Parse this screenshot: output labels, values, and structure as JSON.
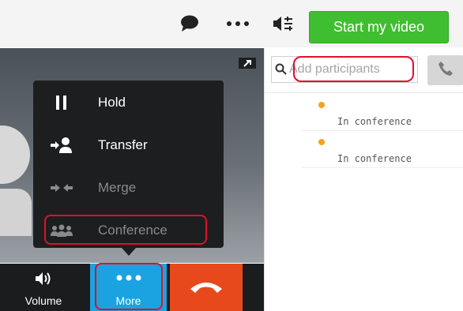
{
  "toolbar": {
    "chat_icon": "chat-bubble-icon",
    "more_icon": "ellipsis-icon",
    "layout_icon": "layout-toggle-icon",
    "start_video_label": "Start my video"
  },
  "call_menu": {
    "items": [
      {
        "label": "Hold",
        "icon": "pause-icon",
        "enabled": true
      },
      {
        "label": "Transfer",
        "icon": "transfer-icon",
        "enabled": true
      },
      {
        "label": "Merge",
        "icon": "merge-icon",
        "enabled": false
      },
      {
        "label": "Conference",
        "icon": "conference-icon",
        "enabled": false
      }
    ]
  },
  "controls": {
    "volume_label": "Volume",
    "more_label": "More",
    "hangup_icon": "hang-up-icon"
  },
  "participants_panel": {
    "search_placeholder": "Add participants",
    "participants": [
      {
        "status": "In conference"
      },
      {
        "status": "In conference"
      }
    ]
  },
  "colors": {
    "start_video": "#3fbf2f",
    "more_active": "#1aa3e0",
    "hangup": "#e8491c",
    "status_dot": "#f5a21d",
    "highlight": "#e0102a"
  }
}
